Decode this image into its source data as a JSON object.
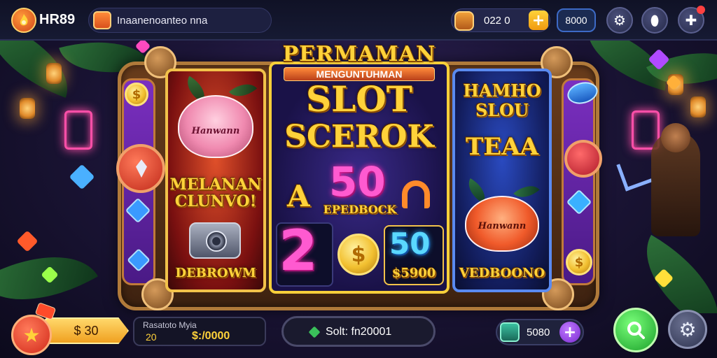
{
  "header": {
    "brand": "HR89",
    "search_value": "Inaanenoanteo nna",
    "coins_value": "022   0",
    "coins_plus": "+",
    "gems_value": "8000",
    "icons": [
      "flame-icon",
      "chest-icon",
      "gear-icon",
      "shield-icon",
      "plus-icon"
    ]
  },
  "machine": {
    "title_top": "PERMAMAN",
    "title_sub": "MENGUNTUHMAN",
    "slot_line1": "SLOT",
    "slot_line2": "SCEROK",
    "left_reel": {
      "rose_label": "Hanwann",
      "main_text": "MELANAN\nCLUNVO!",
      "bottom_text": "DEBROWM"
    },
    "mid_reel": {
      "letter_a": "A",
      "big_num": "50",
      "caption": "EPEDBOCK",
      "num_two": "2",
      "coin_symbol": "$",
      "blue_num": "50",
      "blue_caption": "$5900"
    },
    "right_reel": {
      "title": "HAMHO\nSLOU",
      "subtitle": "TEAA",
      "rose_label": "Hanwann",
      "bottom_text": "VEDBOONO"
    }
  },
  "footer": {
    "star_icon": "star-icon",
    "balance": "$ 30",
    "info_label": "Rasatoto Myia",
    "info_left": "20",
    "info_right": "$:/0000",
    "spin_text": "Solt: fn20001",
    "gift_value": "5080",
    "gift_plus": "+"
  },
  "colors": {
    "accent_gold": "#ffd23a",
    "purple": "#7b2fc0",
    "green": "#1aa02a"
  }
}
